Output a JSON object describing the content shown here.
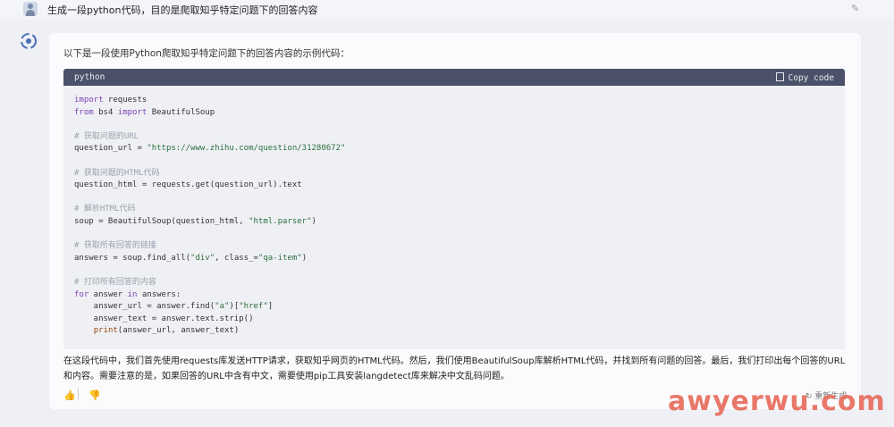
{
  "user": {
    "question": "生成一段python代码，目的是爬取知乎特定问题下的回答内容",
    "edit_icon": "pencil-icon"
  },
  "answer": {
    "intro": "以下是一段使用Python爬取知乎特定问题下的回答内容的示例代码：",
    "code_lang": "python",
    "copy_label": "Copy code",
    "description": "在这段代码中，我们首先使用requests库发送HTTP请求，获取知乎网页的HTML代码。然后，我们使用BeautifulSoup库解析HTML代码，并找到所有问题的回答。最后，我们打印出每个回答的URL和内容。需要注意的是，如果回答的URL中含有中文，需要使用pip工具安装langdetect库来解决中文乱码问题。",
    "regenerate_label": "重新生成"
  },
  "code": {
    "l1_kw": "import",
    "l1_rest": " requests",
    "l2_kw": "from",
    "l2_mid": " bs4 ",
    "l2_kw2": "import",
    "l2_rest": " BeautifulSoup",
    "c1": "# 获取问题的URL",
    "l3_pre": "question_url = ",
    "l3_str": "\"https://www.zhihu.com/question/31280672\"",
    "c2": "# 获取问题的HTML代码",
    "l4": "question_html = requests.get(question_url).text",
    "c3": "# 解析HTML代码",
    "l5_pre": "soup = BeautifulSoup(question_html, ",
    "l5_str": "\"html.parser\"",
    "l5_post": ")",
    "c4": "# 获取所有回答的链接",
    "l6_pre": "answers = soup.find_all(",
    "l6_str1": "\"div\"",
    "l6_mid": ", class_=",
    "l6_str2": "\"qa-item\"",
    "l6_post": ")",
    "c5": "# 打印所有回答的内容",
    "l7_kw": "for",
    "l7_mid": " answer ",
    "l7_kw2": "in",
    "l7_rest": " answers:",
    "l8_pre": "    answer_url = answer.find(",
    "l8_str1": "\"a\"",
    "l8_mid": ")[",
    "l8_str2": "\"href\"",
    "l8_post": "]",
    "l9": "    answer_text = answer.text.strip()",
    "l10_indent": "    ",
    "l10_fn": "print",
    "l10_rest": "(answer_url, answer_text)"
  },
  "watermark": "awyerwu.com",
  "colors": {
    "code_header": "#4a5168",
    "code_bg": "#eff0f4",
    "keyword": "#7b3fb5",
    "string": "#2a6f3f",
    "comment": "#9aa0ad",
    "watermark": "#e86a5a"
  }
}
